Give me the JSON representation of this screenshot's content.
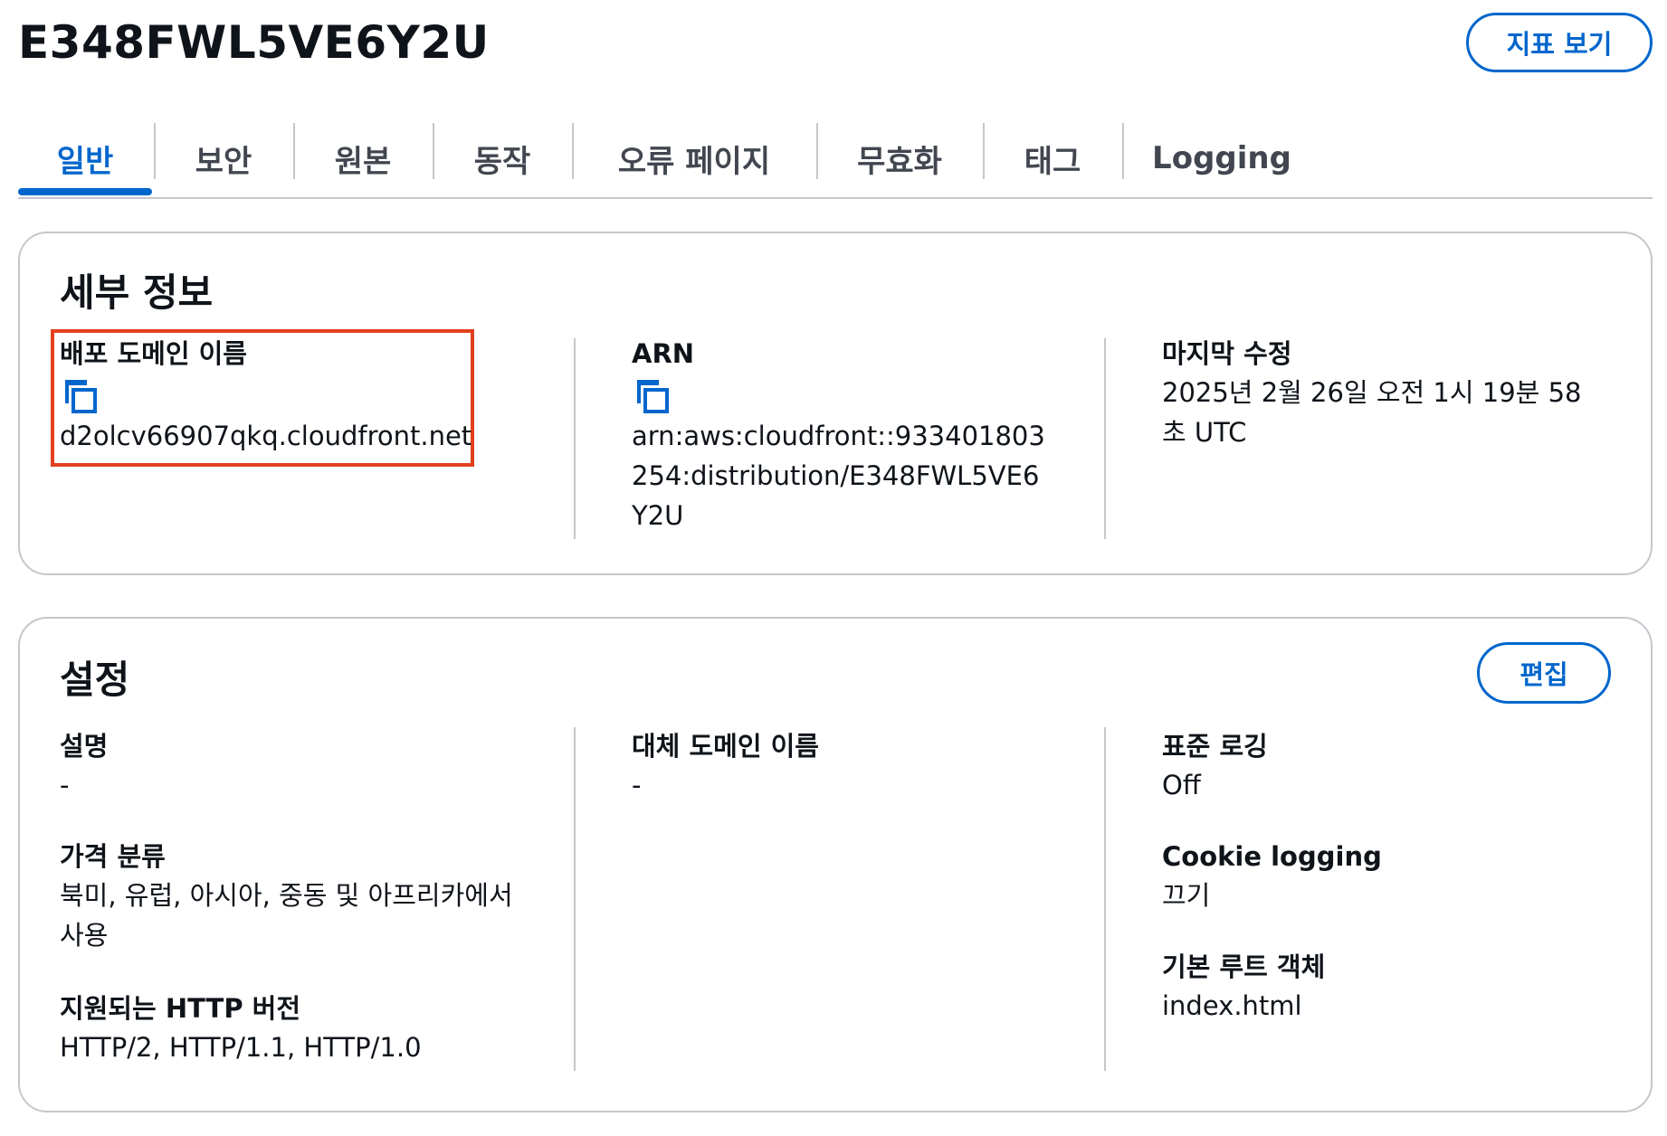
{
  "header": {
    "title": "E348FWL5VE6Y2U",
    "metrics_button": "지표 보기"
  },
  "tabs": [
    {
      "label": "일반",
      "active": true
    },
    {
      "label": "보안",
      "active": false
    },
    {
      "label": "원본",
      "active": false
    },
    {
      "label": "동작",
      "active": false
    },
    {
      "label": "오류 페이지",
      "active": false
    },
    {
      "label": "무효화",
      "active": false
    },
    {
      "label": "태그",
      "active": false
    },
    {
      "label": "Logging",
      "active": false
    }
  ],
  "details": {
    "title": "세부 정보",
    "domain_name": {
      "label": "배포 도메인 이름",
      "icon": "copy-icon",
      "value": "d2olcv66907qkq.cloudfront.net"
    },
    "arn": {
      "label": "ARN",
      "icon": "copy-icon",
      "value_lines": [
        "arn:aws:cloudfront::933401803",
        "254:distribution/E348FWL5VE6",
        "Y2U"
      ]
    },
    "last_modified": {
      "label": "마지막 수정",
      "value_lines": [
        "2025년 2월 26일 오전 1시 19분 58",
        "초 UTC"
      ]
    }
  },
  "settings": {
    "title": "설정",
    "edit_button": "편집",
    "description": {
      "label": "설명",
      "value": "-"
    },
    "price_class": {
      "label": "가격 분류",
      "value_lines": [
        "북미, 유럽, 아시아, 중동 및 아프리카에서",
        "사용"
      ]
    },
    "http_versions": {
      "label": "지원되는 HTTP 버전",
      "value": "HTTP/2, HTTP/1.1, HTTP/1.0"
    },
    "alternate_domain": {
      "label": "대체 도메인 이름",
      "value": "-"
    },
    "standard_logging": {
      "label": "표준 로깅",
      "value": "Off"
    },
    "cookie_logging": {
      "label": "Cookie logging",
      "value": "끄기"
    },
    "default_root_object": {
      "label": "기본 루트 객체",
      "value": "index.html"
    }
  },
  "colors": {
    "accent": "#0066cc",
    "highlight": "#e2401f",
    "border": "#c6c6cd",
    "text": "#0f141a"
  }
}
